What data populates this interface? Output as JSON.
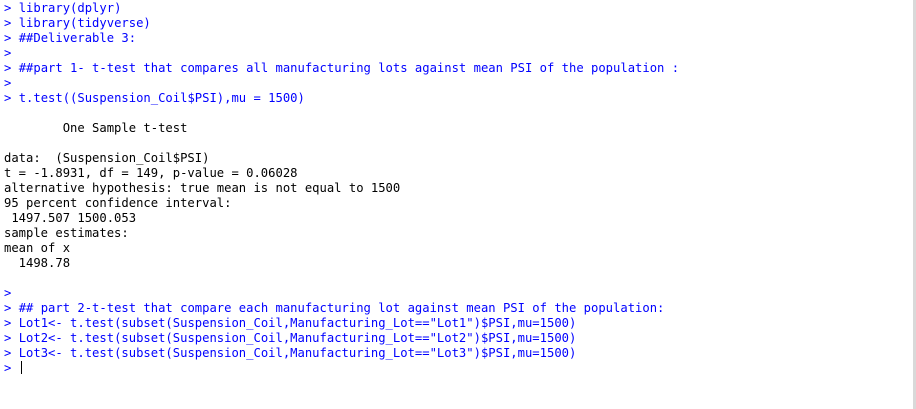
{
  "console": {
    "prompt": "> ",
    "lines": [
      {
        "type": "input",
        "text": "library(dplyr)"
      },
      {
        "type": "input",
        "text": "library(tidyverse)"
      },
      {
        "type": "input",
        "text": "##Deliverable 3:"
      },
      {
        "type": "input",
        "text": ""
      },
      {
        "type": "input",
        "text": "##part 1- t-test that compares all manufacturing lots against mean PSI of the population :"
      },
      {
        "type": "input",
        "text": ""
      },
      {
        "type": "input",
        "text": "t.test((Suspension_Coil$PSI),mu = 1500)"
      },
      {
        "type": "output",
        "text": ""
      },
      {
        "type": "output",
        "text": "        One Sample t-test"
      },
      {
        "type": "output",
        "text": ""
      },
      {
        "type": "output",
        "text": "data:  (Suspension_Coil$PSI)"
      },
      {
        "type": "output",
        "text": "t = -1.8931, df = 149, p-value = 0.06028"
      },
      {
        "type": "output",
        "text": "alternative hypothesis: true mean is not equal to 1500"
      },
      {
        "type": "output",
        "text": "95 percent confidence interval:"
      },
      {
        "type": "output",
        "text": " 1497.507 1500.053"
      },
      {
        "type": "output",
        "text": "sample estimates:"
      },
      {
        "type": "output",
        "text": "mean of x "
      },
      {
        "type": "output",
        "text": "  1498.78 "
      },
      {
        "type": "output",
        "text": ""
      },
      {
        "type": "input",
        "text": ""
      },
      {
        "type": "input",
        "text": "## part 2-t-test that compare each manufacturing lot against mean PSI of the population:"
      },
      {
        "type": "input",
        "text": "Lot1<- t.test(subset(Suspension_Coil,Manufacturing_Lot==\"Lot1\")$PSI,mu=1500)"
      },
      {
        "type": "input",
        "text": "Lot2<- t.test(subset(Suspension_Coil,Manufacturing_Lot==\"Lot2\")$PSI,mu=1500)"
      },
      {
        "type": "input",
        "text": "Lot3<- t.test(subset(Suspension_Coil,Manufacturing_Lot==\"Lot3\")$PSI,mu=1500)"
      }
    ],
    "current_input": ""
  },
  "colors": {
    "input": "#0000ff",
    "output": "#000000",
    "background": "#ffffff"
  }
}
